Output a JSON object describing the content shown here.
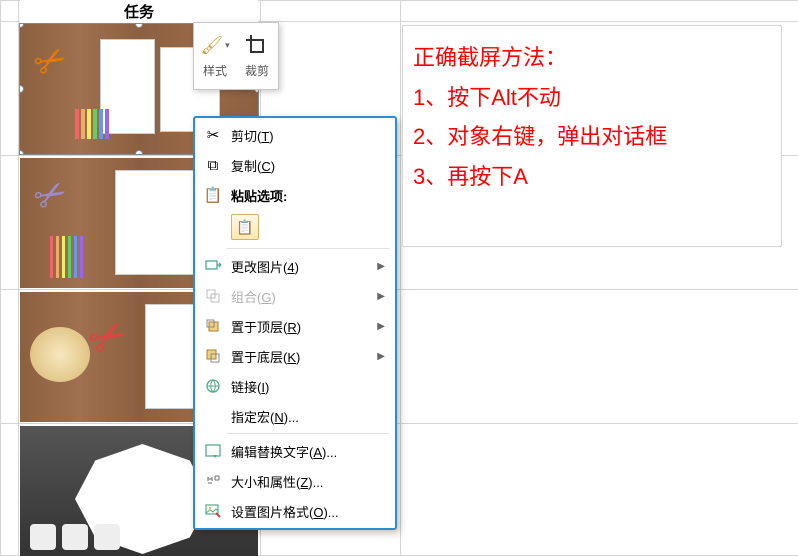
{
  "header": {
    "title": "任务"
  },
  "mini_toolbar": {
    "style_label": "样式",
    "crop_label": "裁剪"
  },
  "ctx": {
    "cut": {
      "label": "剪切(T)",
      "key": "T"
    },
    "copy": {
      "label": "复制(C)",
      "key": "C"
    },
    "paste": {
      "label": "粘贴选项:",
      "key": ""
    },
    "change": {
      "label": "更改图片(4)",
      "key": "4"
    },
    "group": {
      "label": "组合(G)",
      "key": "G"
    },
    "tofront": {
      "label": "置于顶层(R)",
      "key": "R"
    },
    "toback": {
      "label": "置于底层(K)",
      "key": "K"
    },
    "link": {
      "label": "链接(I)",
      "key": "I"
    },
    "macro": {
      "label": "指定宏(N)...",
      "key": "N"
    },
    "alttext": {
      "label": "编辑替换文字(A)...",
      "key": "A"
    },
    "sizeprop": {
      "label": "大小和属性(Z)...",
      "key": "Z"
    },
    "format": {
      "label": "设置图片格式(O)...",
      "key": "O"
    }
  },
  "annotation": {
    "title": "正确截屏方法：",
    "step1": "1、按下Alt不动",
    "step2": "2、对象右键，弹出对话框",
    "step3": "3、再按下A"
  }
}
